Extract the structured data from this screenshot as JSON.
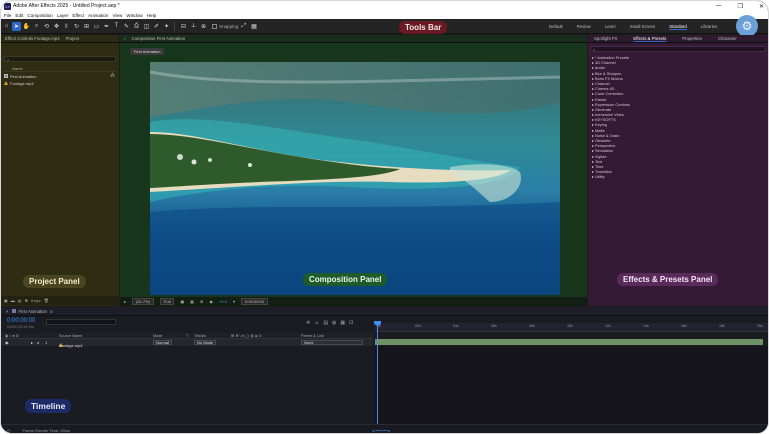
{
  "window": {
    "title": "Adobe After Effects 2025 - Untitled Project.aep *",
    "app_icon_text": "Ae",
    "controls": [
      "—",
      "❐",
      "✕"
    ]
  },
  "menu": [
    "File",
    "Edit",
    "Composition",
    "Layer",
    "Effect",
    "Animation",
    "View",
    "Window",
    "Help"
  ],
  "toolbar": {
    "callout": "Tools Bar",
    "snapping_label": "Snapping",
    "workspaces": [
      "Default",
      "Review",
      "Learn",
      "Small Screen",
      "Standard",
      "Libraries"
    ],
    "active_workspace": "Standard"
  },
  "project_panel": {
    "tabs": [
      "Effect Controls Footage.mp4",
      "Project"
    ],
    "header": "Name",
    "items": [
      {
        "name": "First Animation",
        "type": "composition"
      },
      {
        "name": "Footage.mp4",
        "type": "footage-missing"
      }
    ],
    "bpc": "8 bpc",
    "callout": "Project Panel"
  },
  "composition_panel": {
    "tab": "Composition First Animation",
    "subtab": "First Animation",
    "zoom": "(51.7%)",
    "resolution": "Full",
    "exposure": "+0.0",
    "timecode": "0:00:00:00",
    "callout": "Composition Panel"
  },
  "effects_panel": {
    "tabs": [
      "Spotlight FX",
      "Effects & Presets",
      "Properties",
      "Character"
    ],
    "active_tab": "Effects & Presets",
    "categories": [
      "* Animation Presets",
      "3D Channel",
      "Audio",
      "Blur & Sharpen",
      "Boris FX Mocha",
      "Channel",
      "Cinema 4D",
      "Color Correction",
      "Distort",
      "Expression Controls",
      "Generate",
      "Immersive Video",
      "KEYSOFTS",
      "Keying",
      "Matte",
      "Noise & Grain",
      "Obsolete",
      "Perspective",
      "Simulation",
      "Stylize",
      "Text",
      "Time",
      "Transition",
      "Utility"
    ],
    "callout": "Effects & Presets Panel"
  },
  "timeline": {
    "tab": "First Animation",
    "timecode": "0:00:00:00",
    "fps": "00000 (30.00 fps)",
    "columns": [
      "Source Name",
      "Mode",
      "T",
      "TrkMat",
      "Parent & Link"
    ],
    "layer": {
      "index": "1",
      "name": "Footage.mp4",
      "mode": "Normal",
      "trkmat": "No Matte",
      "parent": "None"
    },
    "ruler": [
      "0s",
      "02s",
      "04s",
      "06s",
      "08s",
      "10s",
      "12s",
      "14s",
      "16s",
      "18s",
      "20s"
    ],
    "footer": "Frame Render Time: 25ms",
    "callout": "Timeline"
  },
  "colors": {
    "accent_blue": "#3e8ef5",
    "project_tint": "#2e2d13",
    "composition_tint": "#17361c",
    "effects_tint": "#341a34",
    "tools_callout": "#6a1a22"
  }
}
